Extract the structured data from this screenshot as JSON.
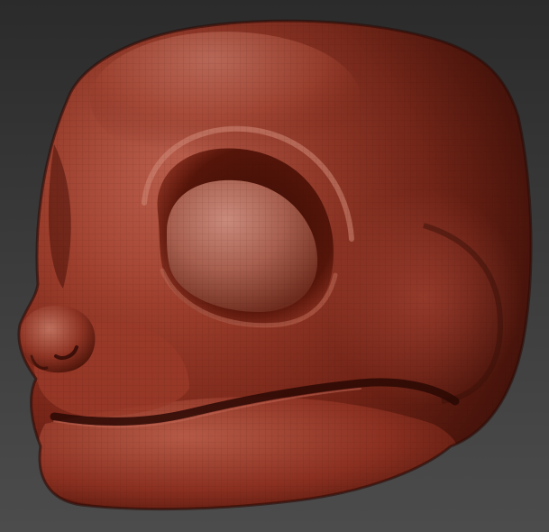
{
  "viewport": {
    "background_top": "#2d2d2d",
    "background_bottom": "#4b4b4b",
    "mesh_color": "#8a2c1d",
    "mesh_highlight": "#d9998a",
    "mesh_shadow": "#3a0f08",
    "wireframe": true
  },
  "model": {
    "icon": "sculpted-head-model-icon",
    "material": "red-wax-matcap"
  }
}
